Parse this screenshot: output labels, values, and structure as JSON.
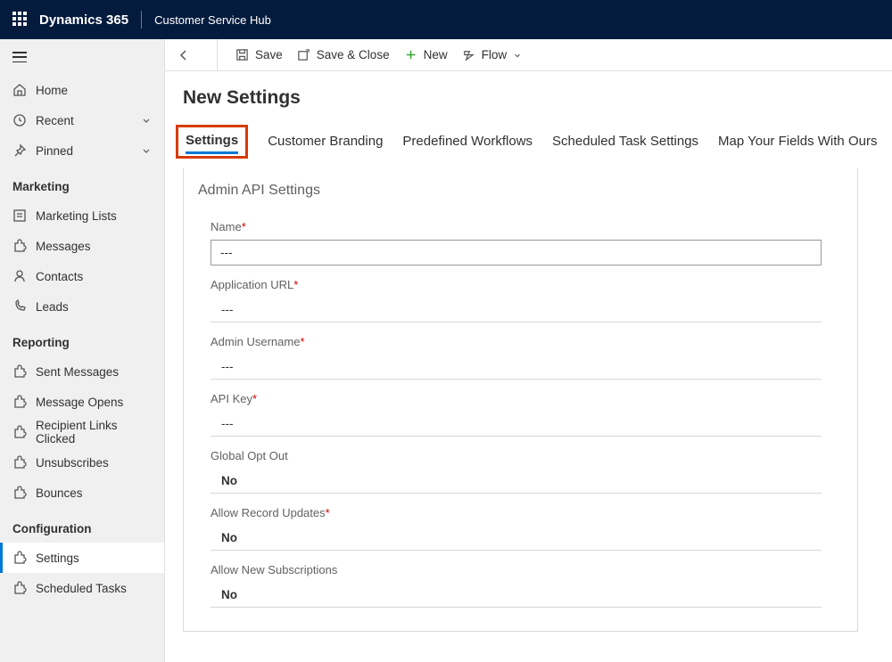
{
  "topbar": {
    "brand": "Dynamics 365",
    "app_name": "Customer Service Hub"
  },
  "sidebar": {
    "home": "Home",
    "recent": "Recent",
    "pinned": "Pinned",
    "groups": [
      {
        "title": "Marketing",
        "items": [
          "Marketing Lists",
          "Messages",
          "Contacts",
          "Leads"
        ]
      },
      {
        "title": "Reporting",
        "items": [
          "Sent Messages",
          "Message Opens",
          "Recipient Links Clicked",
          "Unsubscribes",
          "Bounces"
        ]
      },
      {
        "title": "Configuration",
        "items": [
          "Settings",
          "Scheduled Tasks"
        ]
      }
    ]
  },
  "commands": {
    "save": "Save",
    "save_close": "Save & Close",
    "new": "New",
    "flow": "Flow"
  },
  "page": {
    "title": "New Settings",
    "tabs": [
      "Settings",
      "Customer Branding",
      "Predefined Workflows",
      "Scheduled Task Settings",
      "Map Your Fields With Ours"
    ],
    "active_tab": 0,
    "section_title": "Admin API Settings",
    "fields": [
      {
        "label": "Name",
        "required": true,
        "value": "---",
        "input": true
      },
      {
        "label": "Application URL",
        "required": true,
        "value": "---"
      },
      {
        "label": "Admin Username",
        "required": true,
        "value": "---"
      },
      {
        "label": "API Key",
        "required": true,
        "value": "---"
      },
      {
        "label": "Global Opt Out",
        "required": false,
        "value": "No",
        "bold": true
      },
      {
        "label": "Allow Record Updates",
        "required": true,
        "value": "No",
        "bold": true
      },
      {
        "label": "Allow New Subscriptions",
        "required": false,
        "value": "No",
        "bold": true
      }
    ]
  }
}
